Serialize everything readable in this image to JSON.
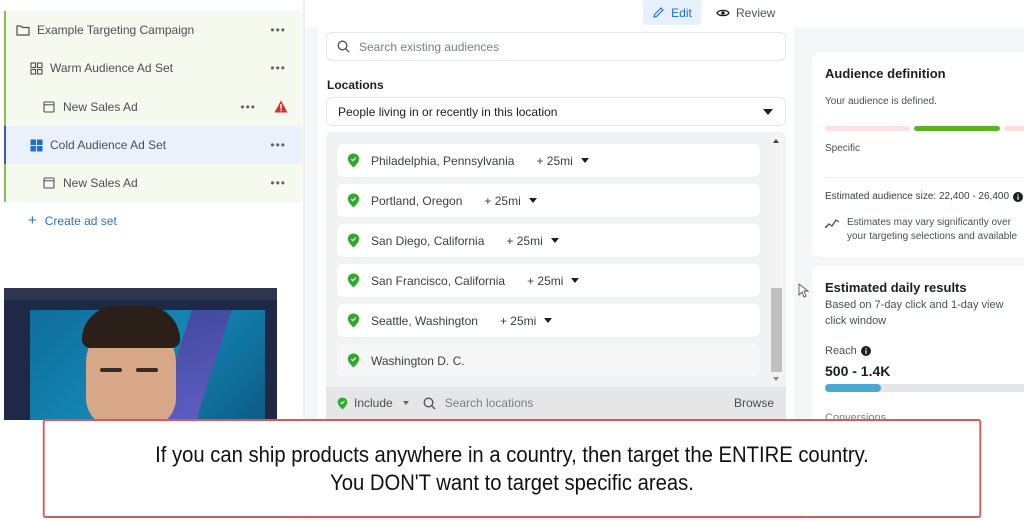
{
  "tree": {
    "campaign": {
      "label": "Example Targeting Campaign",
      "icon": "folder-icon",
      "more": "•••"
    },
    "items": [
      {
        "label": "Warm Audience Ad Set",
        "icon": "ad-set-outline-icon",
        "more": "•••",
        "selected": false
      },
      {
        "label": "New Sales Ad",
        "icon": "ad-icon",
        "more": "•••",
        "warning": true
      },
      {
        "label": "Cold Audience Ad Set",
        "icon": "ad-set-filled-icon",
        "more": "•••",
        "selected": true
      },
      {
        "label": "New Sales Ad",
        "icon": "ad-icon",
        "more": "•••",
        "warning": false
      }
    ],
    "create_label": "Create ad set"
  },
  "tabs": {
    "edit": "Edit",
    "review": "Review",
    "active": "edit"
  },
  "audience_search": {
    "placeholder": "Search existing audiences"
  },
  "locations": {
    "label": "Locations",
    "mode": "People living in or recently in this location",
    "items": [
      {
        "name": "Philadelphia, Pennsylvania",
        "radius": "+ 25mi"
      },
      {
        "name": "Portland, Oregon",
        "radius": "+ 25mi"
      },
      {
        "name": "San Diego, California",
        "radius": "+ 25mi"
      },
      {
        "name": "San Francisco, California",
        "radius": "+ 25mi"
      },
      {
        "name": "Seattle, Washington",
        "radius": "+ 25mi"
      },
      {
        "name": "Washington D. C.",
        "radius": ""
      }
    ],
    "include_label": "Include",
    "search_placeholder": "Search locations",
    "browse_label": "Browse"
  },
  "audience_definition": {
    "title": "Audience definition",
    "status": "Your audience is defined.",
    "breadth": "Specific",
    "size_text": "Estimated audience size: 22,400 - 26,400",
    "estimate_note_line1": "Estimates may vary significantly over",
    "estimate_note_line2": "your targeting selections and available"
  },
  "daily_results": {
    "title": "Estimated daily results",
    "subtitle": "Based on 7-day click and 1-day view click window",
    "reach_label": "Reach",
    "reach_value": "500 - 1.4K",
    "reach_fill_fraction": 0.28,
    "next_label": "Conversions"
  },
  "caption": {
    "line1": "If you can ship products anywhere in a country, then target the ENTIRE country.",
    "line2": "You DON'T want to target specific areas."
  },
  "colors": {
    "accent_blue": "#1a6ed8",
    "pin_green": "#2eaa2e",
    "meter_green": "#5cb320",
    "reach_blue": "#49a9d4",
    "warning_red": "#d93025",
    "caption_border": "#e05555"
  }
}
